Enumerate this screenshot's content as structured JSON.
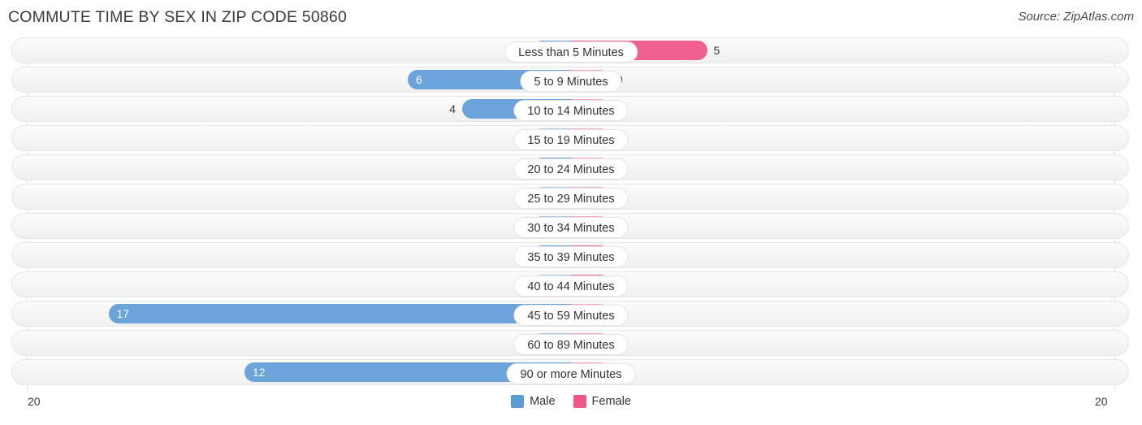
{
  "header": {
    "title": "COMMUTE TIME BY SEX IN ZIP CODE 50860",
    "source": "Source: ZipAtlas.com"
  },
  "footer": {
    "axis_left": "20",
    "axis_right": "20"
  },
  "legend": {
    "items": [
      {
        "label": "Male",
        "color": "#5b9bd5"
      },
      {
        "label": "Female",
        "color": "#f0548c"
      }
    ]
  },
  "colors": {
    "male": "#6ba3db",
    "male_zero": "#a8cbea",
    "female": "#f0608f",
    "female_zero": "#f9a8c2",
    "track": "#f5f5f5",
    "gridline": "#e2e2e2"
  },
  "chart_data": {
    "type": "bar",
    "subtype": "diverging-butterfly",
    "title": "COMMUTE TIME BY SEX IN ZIP CODE 50860",
    "xlabel": "",
    "ylabel": "",
    "axis_max": 20,
    "xlim": [
      20,
      20
    ],
    "grid": true,
    "legend_position": "bottom-center",
    "categories": [
      "Less than 5 Minutes",
      "5 to 9 Minutes",
      "10 to 14 Minutes",
      "15 to 19 Minutes",
      "20 to 24 Minutes",
      "25 to 29 Minutes",
      "30 to 34 Minutes",
      "35 to 39 Minutes",
      "40 to 44 Minutes",
      "45 to 59 Minutes",
      "60 to 89 Minutes",
      "90 or more Minutes"
    ],
    "series": [
      {
        "name": "Male",
        "direction": "left",
        "color": "#6ba3db",
        "values": [
          1,
          6,
          4,
          0,
          1,
          0,
          0,
          1,
          0,
          17,
          0,
          12
        ],
        "labels": [
          "1",
          "6",
          "4",
          "0",
          "1",
          "0",
          "0",
          "1",
          "0",
          "17",
          "0",
          "12"
        ]
      },
      {
        "name": "Female",
        "direction": "right",
        "color": "#f0608f",
        "values": [
          5,
          0,
          0,
          0,
          0,
          0,
          0,
          1,
          1,
          0,
          0,
          0
        ],
        "labels": [
          "5",
          "0",
          "0",
          "0",
          "0",
          "0",
          "0",
          "1",
          "1",
          "0",
          "0",
          "0"
        ]
      }
    ]
  }
}
